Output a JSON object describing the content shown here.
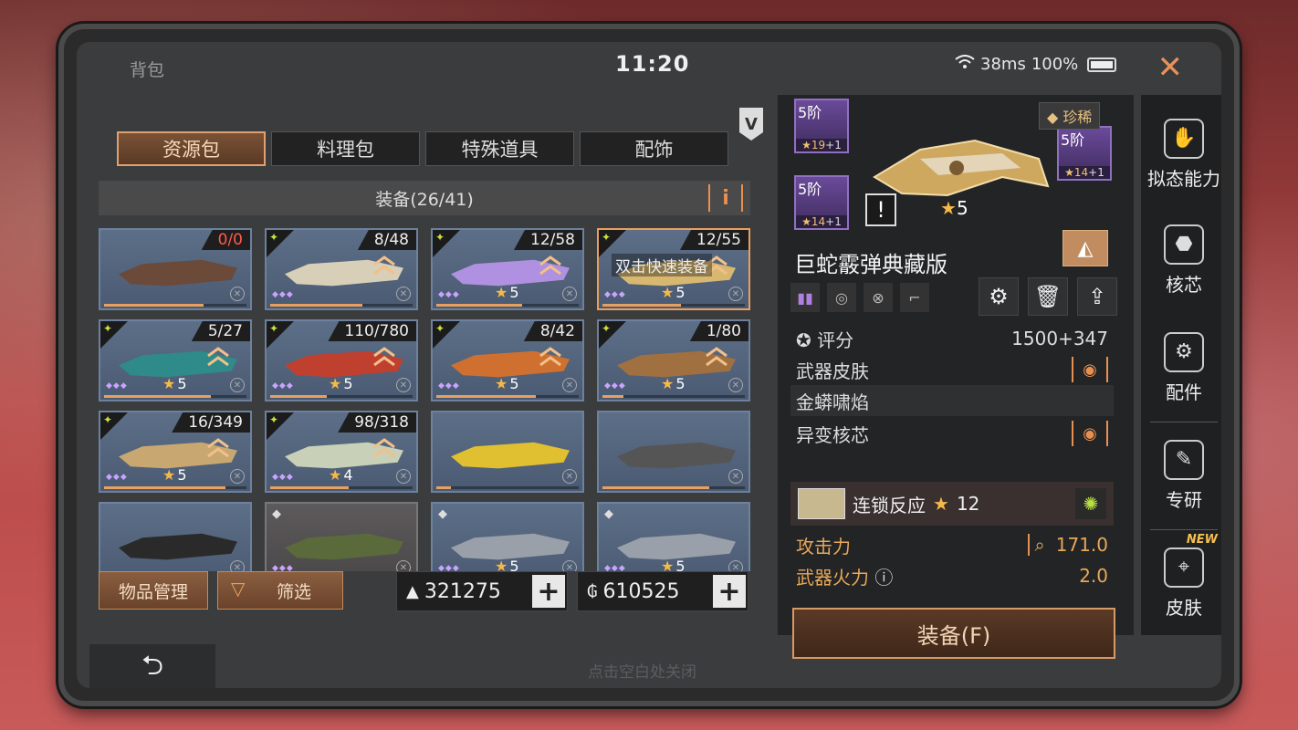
{
  "status": {
    "title": "背包",
    "clock": "11:20",
    "ping": "38ms",
    "battery": "100%"
  },
  "tabs": [
    {
      "label": "资源包",
      "active": true
    },
    {
      "label": "料理包",
      "active": false
    },
    {
      "label": "特殊道具",
      "active": false
    },
    {
      "label": "配饰",
      "active": false
    }
  ],
  "equip_header": "装备(26/41)",
  "info_label": "i",
  "grid": [
    {
      "count": "0/0",
      "red": true,
      "stars": "",
      "kind": "fishing-rod",
      "progress": 0.7
    },
    {
      "count": "8/48",
      "stars": "",
      "kind": "pistol",
      "progress": 0.65
    },
    {
      "count": "12/58",
      "stars": "5",
      "kind": "crossbow",
      "progress": 0.6
    },
    {
      "count": "12/55",
      "stars": "5",
      "kind": "serpent",
      "overlay": "双击快速装备",
      "selected": true,
      "progress": 0.55
    },
    {
      "count": "5/27",
      "stars": "5",
      "kind": "rifle-teal",
      "progress": 0.75
    },
    {
      "count": "110/780",
      "stars": "5",
      "kind": "rifle-red",
      "progress": 0.4
    },
    {
      "count": "8/42",
      "stars": "5",
      "kind": "rifle-orange",
      "progress": 0.7
    },
    {
      "count": "1/80",
      "stars": "5",
      "kind": "bow",
      "progress": 0.15
    },
    {
      "count": "16/349",
      "stars": "5",
      "kind": "rifle-camo",
      "progress": 0.85
    },
    {
      "count": "98/318",
      "stars": "4",
      "kind": "rifle-pale",
      "progress": 0.55
    },
    {
      "count": "",
      "stars": "",
      "kind": "jetski",
      "progress": 0.1
    },
    {
      "count": "",
      "stars": "",
      "kind": "axe",
      "progress": 0.75
    },
    {
      "count": "",
      "stars": "",
      "kind": "pickaxe",
      "progress": 0
    },
    {
      "count": "",
      "stars": "",
      "kind": "vest",
      "gray": true,
      "progress": 0
    },
    {
      "count": "",
      "stars": "5",
      "kind": "robot",
      "progress": 0
    },
    {
      "count": "",
      "stars": "5",
      "kind": "robot",
      "progress": 0
    }
  ],
  "buttons": {
    "manage": "物品管理",
    "filter": "筛选"
  },
  "currency": [
    {
      "value": "321275",
      "icon": "mountain-icon"
    },
    {
      "value": "610525",
      "icon": "coin-icon"
    }
  ],
  "hint": "点击空白处关闭",
  "detail": {
    "rarity": "珍稀",
    "mods": [
      {
        "level": "5阶",
        "stars": "19",
        "bonus": "+1"
      },
      {
        "level": "5阶",
        "stars": "14",
        "bonus": "+1"
      },
      {
        "level": "5阶",
        "stars": "14",
        "bonus": "+1"
      }
    ],
    "weapon_stars": "5",
    "weapon_name": "巨蛇霰弹典藏版",
    "score_label": "评分",
    "score_value": "1500+347",
    "skin_label": "武器皮肤",
    "skin_name": "金蟒啸焰",
    "core_label": "异变核芯",
    "core_name": "连锁反应",
    "core_stars": "12",
    "attack_label": "攻击力",
    "attack_value": "171.0",
    "fire_label": "武器火力",
    "fire_value": "2.0",
    "equip_label": "装备(F)"
  },
  "sidebar": [
    {
      "label": "拟态能力",
      "icon": "mimic-icon"
    },
    {
      "label": "核芯",
      "icon": "core-icon"
    },
    {
      "label": "配件",
      "icon": "parts-icon"
    },
    {
      "label": "专研",
      "icon": "research-icon"
    },
    {
      "label": "皮肤",
      "icon": "skin-icon",
      "badge": "NEW"
    }
  ],
  "colors": {
    "accent": "#e8a060",
    "panel": "#222426",
    "cell": "#5d6f88"
  }
}
